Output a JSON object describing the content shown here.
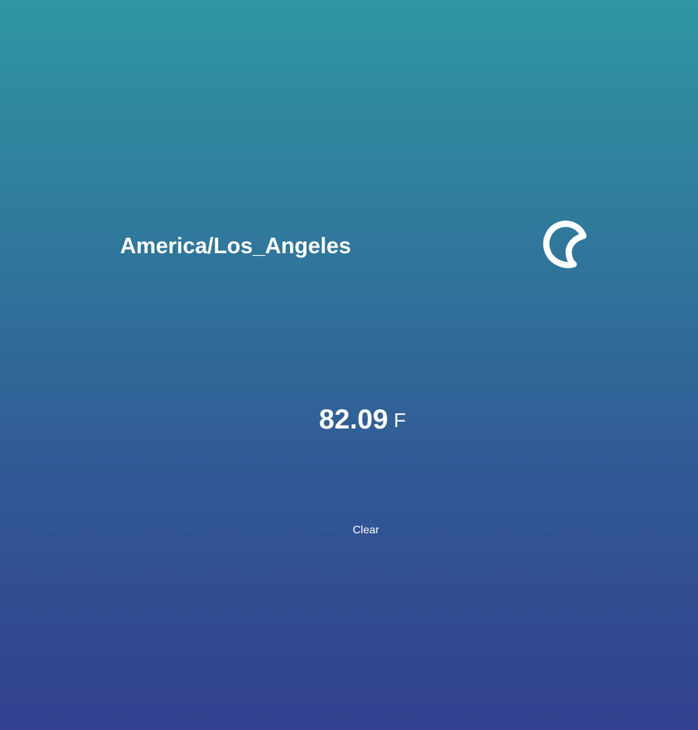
{
  "location": {
    "timezone": "America/Los_Angeles"
  },
  "weather": {
    "icon": "clear-night-moon-icon",
    "temperature": "82.09",
    "unit": "F"
  },
  "actions": {
    "clear_label": "Clear"
  },
  "colors": {
    "gradient_top": "#2f96a2",
    "gradient_bottom": "#32408f",
    "text": "#ffffff"
  }
}
